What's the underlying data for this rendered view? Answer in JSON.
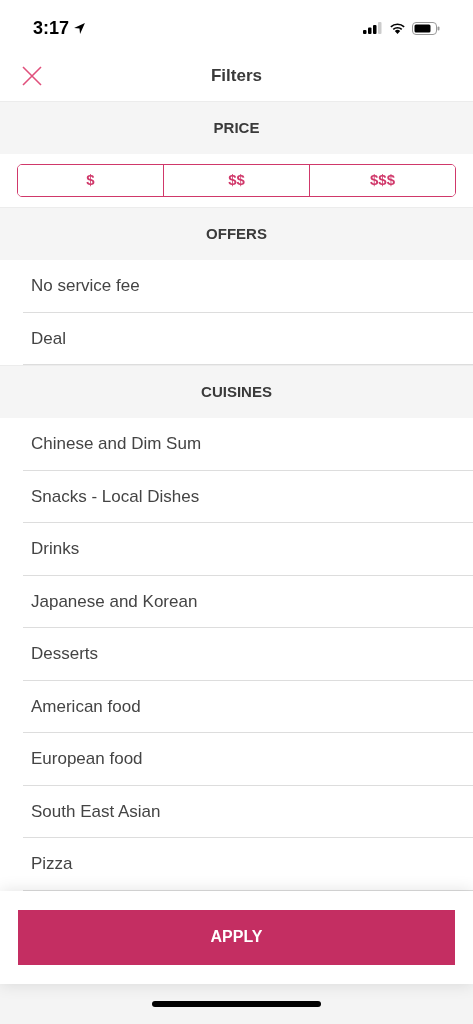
{
  "status_bar": {
    "time": "3:17"
  },
  "header": {
    "title": "Filters"
  },
  "sections": [
    {
      "title": "PRICE",
      "kind": "segments",
      "options": [
        {
          "label": "$",
          "selected": false
        },
        {
          "label": "$$",
          "selected": false
        },
        {
          "label": "$$$",
          "selected": false
        }
      ]
    },
    {
      "title": "OFFERS",
      "kind": "list",
      "items": [
        "No service fee",
        "Deal"
      ]
    },
    {
      "title": "CUISINES",
      "kind": "list",
      "items": [
        "Chinese and Dim Sum",
        "Snacks - Local Dishes",
        "Drinks",
        "Japanese and Korean",
        "Desserts",
        "American food",
        "European food",
        "South East Asian",
        "Pizza"
      ]
    }
  ],
  "apply_button": {
    "label": "APPLY"
  }
}
